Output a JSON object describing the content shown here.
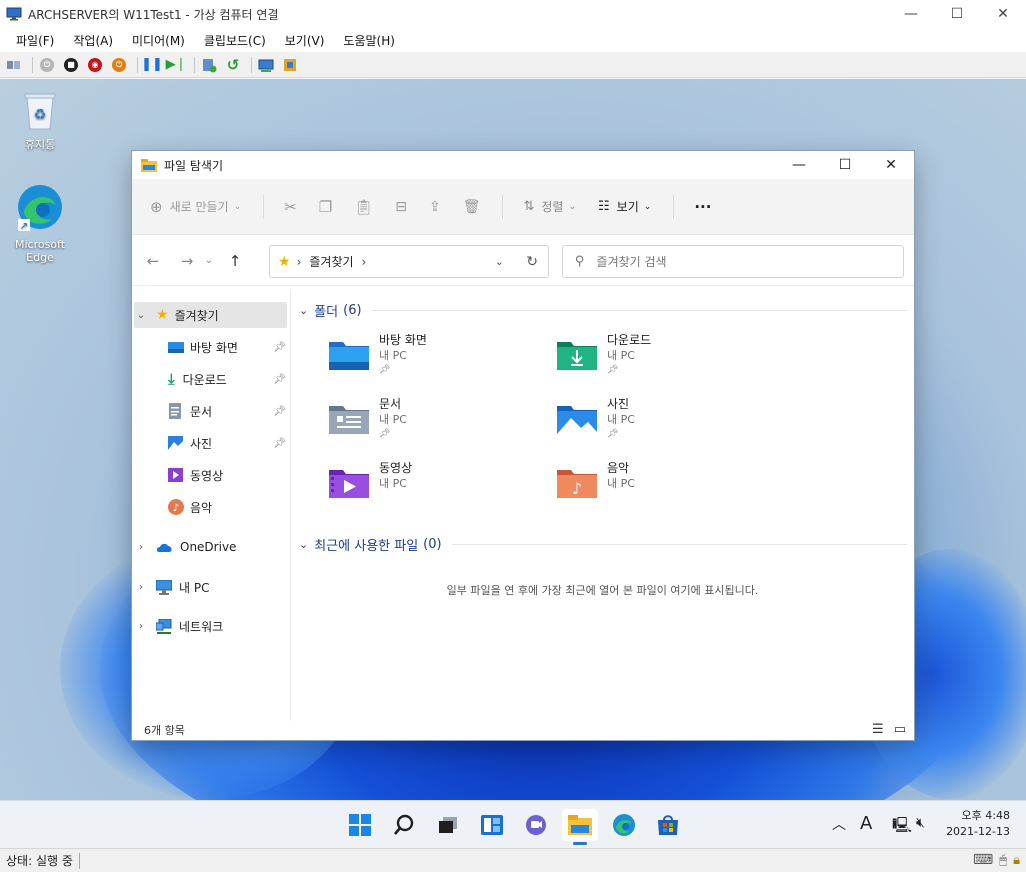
{
  "vm_window": {
    "title": "ARCHSERVER의 W11Test1 - 가상 컴퓨터 연결",
    "menu": [
      "파일(F)",
      "작업(A)",
      "미디어(M)",
      "클립보드(C)",
      "보기(V)",
      "도움말(H)"
    ],
    "status": "상태: 실행 중"
  },
  "desktop": {
    "icons": [
      {
        "label": "휴지통",
        "icon": "recycle-bin-icon"
      },
      {
        "label": "Microsoft Edge",
        "icon": "edge-icon"
      }
    ]
  },
  "explorer": {
    "title": "파일 탐색기",
    "commands": {
      "new": "새로 만들기",
      "sort": "정렬",
      "view": "보기",
      "more": "···"
    },
    "address": {
      "crumb": "즐겨찾기",
      "separator": "›"
    },
    "search_placeholder": "즐겨찾기 검색",
    "nav": {
      "quick_access": "즐겨찾기",
      "pinned": [
        {
          "label": "바탕 화면",
          "icon": "desktop-folder-icon",
          "pinned": true
        },
        {
          "label": "다운로드",
          "icon": "downloads-icon",
          "pinned": true
        },
        {
          "label": "문서",
          "icon": "documents-icon",
          "pinned": true
        },
        {
          "label": "사진",
          "icon": "pictures-icon",
          "pinned": true
        },
        {
          "label": "동영상",
          "icon": "videos-icon",
          "pinned": false
        },
        {
          "label": "음악",
          "icon": "music-icon",
          "pinned": false
        }
      ],
      "onedrive": "OneDrive",
      "this_pc": "내 PC",
      "network": "네트워크"
    },
    "groups": {
      "folders": {
        "label": "폴더",
        "count": "(6)"
      },
      "recent": {
        "label": "최근에 사용한 파일",
        "count": "(0)"
      }
    },
    "folders": [
      {
        "name": "바탕 화면",
        "location": "내 PC",
        "pinned": true,
        "color": "#2a8ce0"
      },
      {
        "name": "다운로드",
        "location": "내 PC",
        "pinned": true,
        "color": "#1ba37c"
      },
      {
        "name": "문서",
        "location": "내 PC",
        "pinned": true,
        "color": "#8a97a7"
      },
      {
        "name": "사진",
        "location": "내 PC",
        "pinned": true,
        "color": "#2a7fe0"
      },
      {
        "name": "동영상",
        "location": "내 PC",
        "pinned": false,
        "color": "#8b3fd1"
      },
      {
        "name": "음악",
        "location": "내 PC",
        "pinned": false,
        "color": "#e27a4f"
      }
    ],
    "empty_recent_message": "일부 파일을 연 후에 가장 최근에 열어 본 파일이 여기에 표시됩니다.",
    "status_count": "6개 항목"
  },
  "taskbar": {
    "tray_input": "A",
    "time": "오후 4:48",
    "date": "2021-12-13"
  }
}
